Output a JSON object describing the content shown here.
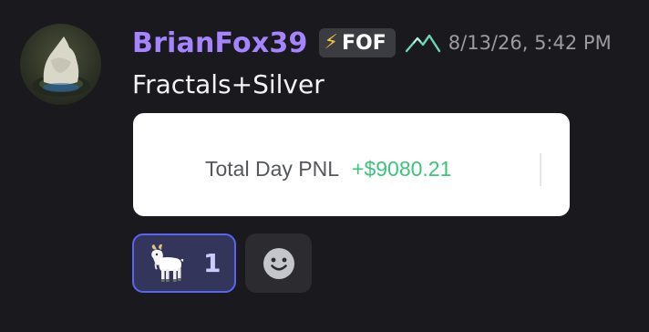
{
  "message": {
    "author": "BrianFox39",
    "role_tag": {
      "icon": "lightning-bolt-icon",
      "bolt": "⚡",
      "label": "FOF"
    },
    "badge_icon": "mountain-icon",
    "timestamp": "8/13/26, 5:42 PM",
    "text": "Fractals+Silver"
  },
  "embed": {
    "label": "Total Day PNL",
    "value": "+$9080.21"
  },
  "reactions": [
    {
      "emoji": "goat-emoji-icon",
      "count": "1",
      "selected": true
    }
  ],
  "add_reaction_icon": "smiley-face-icon",
  "colors": {
    "background": "#1a1a1e",
    "username": "#a684ff",
    "pnl_positive": "#3cc47a",
    "reaction_selected_border": "#5865f2"
  }
}
